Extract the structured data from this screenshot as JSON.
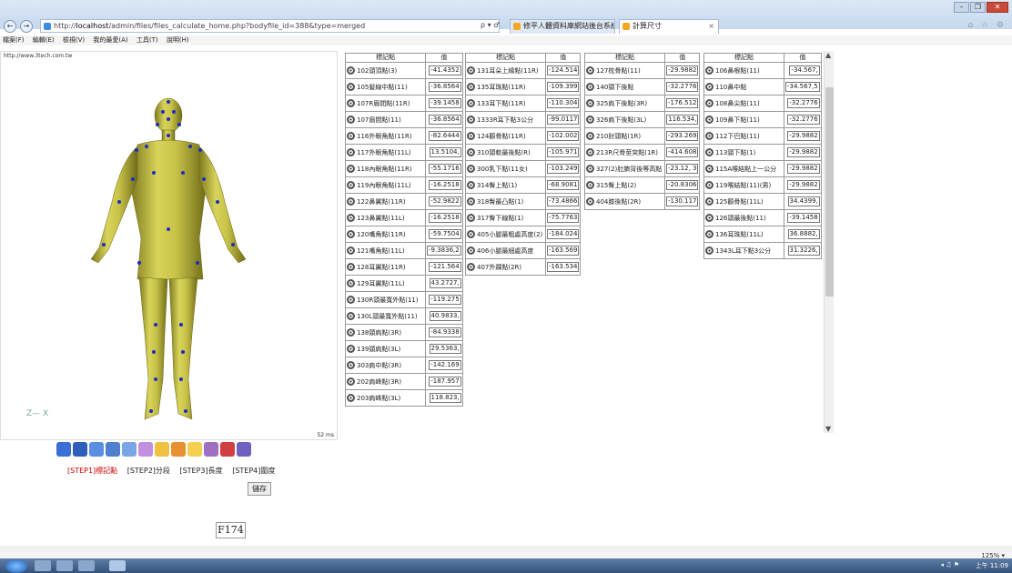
{
  "browser": {
    "url_prefix": "http://",
    "url_host": "localhost",
    "url_path": "/admin/files/files_calculate_home.php?bodyfile_id=388&type=merged",
    "search_ctl": "ρ ▾ ♂",
    "tab1": "修平人體資料庫網站後台系統",
    "tab2": "計算尺寸",
    "tab_close": "×",
    "right_icons": "⌂ ☆ ⚙",
    "winctl": [
      "–",
      "❐",
      "✕"
    ],
    "nav_back": "←",
    "nav_fwd": "→"
  },
  "menu": [
    "檔案(F)",
    "編輯(E)",
    "檢視(V)",
    "我的最愛(A)",
    "工具(T)",
    "說明(H)"
  ],
  "viewer": {
    "link": "http://www.3tech.com.tw",
    "ms": "52 ms",
    "axis_label": "Z— X"
  },
  "steps": [
    {
      "label": "[STEP1]標記點",
      "active": true
    },
    {
      "label": "[STEP2]分段",
      "active": false
    },
    {
      "label": "[STEP3]長度",
      "active": false
    },
    {
      "label": "[STEP4]圍度",
      "active": false
    }
  ],
  "save_label": "儲存",
  "file_id": "F174",
  "headers": {
    "name": "標記點",
    "value": "值"
  },
  "col1": [
    {
      "n": "102頭頂點(3)",
      "v": "-41.4352"
    },
    {
      "n": "105髮線中點(11)",
      "v": "-36.8564"
    },
    {
      "n": "107R眉間點(11R)",
      "v": "-39.1458"
    },
    {
      "n": "107眉間點(11)",
      "v": "-36.8564"
    },
    {
      "n": "116外眼角點(11R)",
      "v": "-82.6444"
    },
    {
      "n": "117外眼角點(11L)",
      "v": "13.5104,"
    },
    {
      "n": "118內眼角點(11R)",
      "v": "-55.1716"
    },
    {
      "n": "119內眼角點(11L)",
      "v": "-16.2518"
    },
    {
      "n": "122鼻翼點(11R)",
      "v": "-52.9822"
    },
    {
      "n": "123鼻翼點(11L)",
      "v": "-16.2518"
    },
    {
      "n": "120嘴角點(11R)",
      "v": "-59.7504"
    },
    {
      "n": "121嘴角點(11L)",
      "v": "-9.3836,2"
    },
    {
      "n": "128耳翼點(11R)",
      "v": "-121.564"
    },
    {
      "n": "129耳翼點(11L)",
      "v": "43.2727,"
    },
    {
      "n": "130R頭最寬外點(11)",
      "v": "-119.275"
    },
    {
      "n": "130L頭最寬外點(11)",
      "v": "40.9833,"
    },
    {
      "n": "138頸肩點(3R)",
      "v": "-84.9338"
    },
    {
      "n": "139頸肩點(3L)",
      "v": "29.5363,"
    },
    {
      "n": "303肩中點(3R)",
      "v": "-142.169"
    },
    {
      "n": "202肩峰點(3R)",
      "v": "-187.957"
    },
    {
      "n": "203肩峰點(3L)",
      "v": "118.823,"
    }
  ],
  "col2": [
    {
      "n": "131耳朵上緣點(11R)",
      "v": "-124.514"
    },
    {
      "n": "135耳珠點(11R)",
      "v": "-109.399"
    },
    {
      "n": "133耳下點(11R)",
      "v": "-110.304"
    },
    {
      "n": "1333R耳下點3公分",
      "v": "-99.0117"
    },
    {
      "n": "124顴骨點(11R)",
      "v": "-102.002"
    },
    {
      "n": "310頸軟最後點(R)",
      "v": "-105.971"
    },
    {
      "n": "300乳下點(11女)",
      "v": "-103.249"
    },
    {
      "n": "314臀上點(1)",
      "v": "-68.9081"
    },
    {
      "n": "318臀最凸點(1)",
      "v": "-73.4866"
    },
    {
      "n": "317臀下線點(1)",
      "v": "-75.7763"
    },
    {
      "n": "405小腿最粗處高度(2)",
      "v": "-184.024"
    },
    {
      "n": "406小腿最細處高度",
      "v": "-163.569"
    },
    {
      "n": "407外踝點(2R)",
      "v": "-163.534"
    }
  ],
  "col3": [
    {
      "n": "127枕骨點(11)",
      "v": "-29.9882"
    },
    {
      "n": "140頸下後點",
      "v": "-32.2776"
    },
    {
      "n": "325肩下後點(3R)",
      "v": "-176.512"
    },
    {
      "n": "326肩下後點(3L)",
      "v": "116.534,"
    },
    {
      "n": "210肘頭點(1R)",
      "v": "-293.269"
    },
    {
      "n": "213R尺骨莖突點(1R)",
      "v": "-414.608"
    },
    {
      "n": "327(2)肚臍背後等高點",
      "v": "-23.12, 3"
    },
    {
      "n": "315臀上點(2)",
      "v": "-20.8306"
    },
    {
      "n": "404膝後點(2R)",
      "v": "-130.117"
    }
  ],
  "col4": [
    {
      "n": "106鼻根點(11)",
      "v": "-34.567,"
    },
    {
      "n": "110鼻中點",
      "v": "-34.567,5"
    },
    {
      "n": "108鼻尖點(11)",
      "v": "-32.2776"
    },
    {
      "n": "109鼻下點(11)",
      "v": "-32.2776"
    },
    {
      "n": "112下巴點(11)",
      "v": "-29.9882"
    },
    {
      "n": "113頸下點(1)",
      "v": "-29.9882"
    },
    {
      "n": "115A喉結點上一公分",
      "v": "-29.9882"
    },
    {
      "n": "119喉結點(11)(男)",
      "v": "-29.9882"
    },
    {
      "n": "125顴骨點(11L)",
      "v": "34.4399,"
    },
    {
      "n": "126頭最後點(11)",
      "v": "-39.1458"
    },
    {
      "n": "136耳珠點(11L)",
      "v": "36.8882,"
    },
    {
      "n": "1343L耳下點3公分",
      "v": "31.3226,"
    }
  ],
  "zoom": "125%  ▾",
  "clock": "上午 11:09",
  "tray": "◂ ♫ ⚑"
}
